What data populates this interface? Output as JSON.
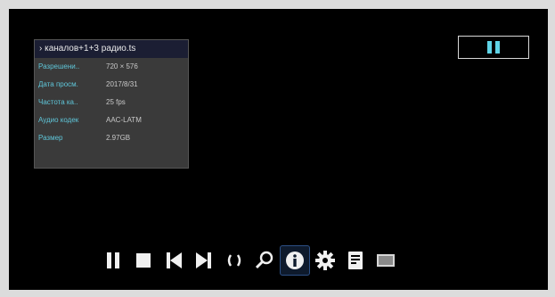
{
  "info": {
    "title": "› каналов+1+3 радио.ts",
    "rows": [
      {
        "key": "Разрешени..",
        "value": "720 × 576"
      },
      {
        "key": "Дата просм.",
        "value": "2017/8/31"
      },
      {
        "key": "Частота ка..",
        "value": "25 fps"
      },
      {
        "key": "Аудио кодек",
        "value": "AAC-LATM"
      },
      {
        "key": "Размер",
        "value": "2.97GB"
      }
    ]
  },
  "status": {
    "icon": "pause-icon",
    "color": "#5fd3e6"
  },
  "toolbar": {
    "buttons": [
      {
        "name": "pause-button",
        "icon": "pause-icon"
      },
      {
        "name": "stop-button",
        "icon": "stop-icon"
      },
      {
        "name": "previous-button",
        "icon": "skip-back-icon"
      },
      {
        "name": "next-button",
        "icon": "skip-forward-icon"
      },
      {
        "name": "ab-repeat-button",
        "icon": "brackets-icon"
      },
      {
        "name": "search-button",
        "icon": "magnifier-icon"
      },
      {
        "name": "info-button",
        "icon": "info-icon",
        "active": true
      },
      {
        "name": "settings-button",
        "icon": "gear-icon"
      },
      {
        "name": "playlist-button",
        "icon": "document-icon"
      },
      {
        "name": "aspect-ratio-button",
        "icon": "screen-icon"
      }
    ]
  },
  "colors": {
    "background": "#000000",
    "panel": "#3a3a3a",
    "key": "#5fc6d9",
    "accent": "#5fd3e6"
  }
}
